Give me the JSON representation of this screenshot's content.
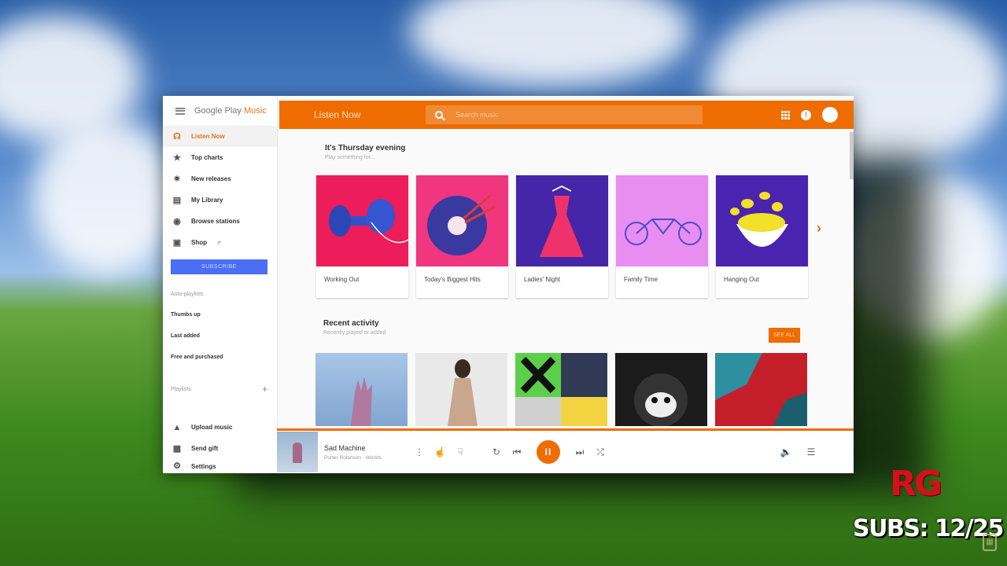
{
  "app": {
    "brand": "Google Play",
    "brand_highlight": "Music",
    "page_title": "Listen Now"
  },
  "search": {
    "placeholder": "Search music"
  },
  "sidebar": {
    "items": [
      {
        "label": "Listen Now",
        "icon": "headphones-icon"
      },
      {
        "label": "Top charts",
        "icon": "star-icon"
      },
      {
        "label": "New releases",
        "icon": "new-icon"
      },
      {
        "label": "My Library",
        "icon": "library-icon"
      },
      {
        "label": "Browse stations",
        "icon": "radio-icon"
      },
      {
        "label": "Shop",
        "icon": "shop-icon"
      }
    ],
    "subscribe_label": "SUBSCRIBE",
    "auto_playlists_title": "Auto-playlists",
    "auto_playlists": [
      "Thumbs up",
      "Last added",
      "Free and purchased"
    ],
    "playlists_title": "Playlists",
    "bottom_items": [
      {
        "label": "Upload music",
        "icon": "upload-icon"
      },
      {
        "label": "Send gift",
        "icon": "gift-icon"
      },
      {
        "label": "Settings",
        "icon": "settings-icon"
      }
    ]
  },
  "main": {
    "section1": {
      "title": "It's Thursday evening",
      "subtitle": "Play something for...",
      "cards": [
        "Working Out",
        "Today's Biggest Hits",
        "Ladies' Night",
        "Family Time",
        "Hanging Out"
      ]
    },
    "section2": {
      "title": "Recent activity",
      "subtitle": "Recently played or added",
      "see_all": "SEE ALL"
    }
  },
  "player": {
    "title": "Sad Machine",
    "artist": "Porter Robinson - Worlds"
  },
  "overlay": {
    "logo": "RG",
    "subs": "SUBS: 12/25"
  },
  "colors": {
    "accent": "#ef6c00",
    "subscribe": "#4a6ef5"
  }
}
